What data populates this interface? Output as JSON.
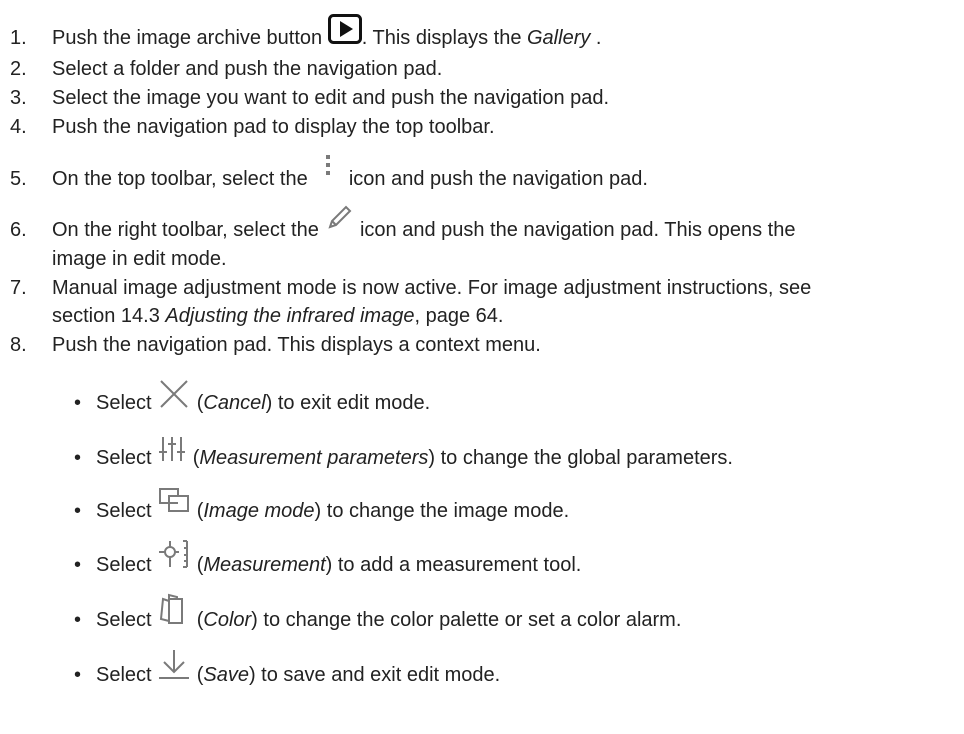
{
  "steps": [
    {
      "n": "1.",
      "a": "Push the image archive button ",
      "b": ". This displays the ",
      "c": "Gallery",
      "d": " ."
    },
    {
      "n": "2.",
      "a": "Select a folder and push the navigation pad."
    },
    {
      "n": "3.",
      "a": "Select the image you want to edit and push the navigation pad."
    },
    {
      "n": "4.",
      "a": "Push the navigation pad to display the top toolbar."
    },
    {
      "n": "5.",
      "a": "On the top toolbar, select the ",
      "b": " icon and push the navigation pad."
    },
    {
      "n": "6.",
      "a": "On the right toolbar, select the ",
      "b": " icon and push the navigation pad. This opens the",
      "c": "image in edit mode."
    },
    {
      "n": "7.",
      "a": "Manual image adjustment mode is now active. For image adjustment instructions, see",
      "b": "section 14.3 ",
      "c": "Adjusting the infrared image",
      "d": ", page 64."
    },
    {
      "n": "8.",
      "a": "Push the navigation pad. This displays a context menu."
    }
  ],
  "options": [
    {
      "icon": "close-icon",
      "pre": "Select ",
      "name": "Cancel",
      "desc": ") to exit edit mode."
    },
    {
      "icon": "sliders-icon",
      "pre": "Select ",
      "name": "Measurement parameters",
      "desc": ") to change the global parameters."
    },
    {
      "icon": "image-mode-icon",
      "pre": "Select ",
      "name": "Image mode",
      "desc": ") to change the image mode."
    },
    {
      "icon": "measurement-icon",
      "pre": "Select ",
      "name": "Measurement",
      "desc": ") to add a measurement tool."
    },
    {
      "icon": "color-palette-icon",
      "pre": "Select ",
      "name": "Color",
      "desc": ") to change the color palette or set a color alarm."
    },
    {
      "icon": "save-icon",
      "pre": "Select ",
      "name": "Save",
      "desc": ") to save and exit edit mode."
    }
  ],
  "bullet": "•",
  "paren_open": " (",
  "colors": {
    "text": "#222222",
    "icon": "#7a7a7a",
    "button": "#111111"
  }
}
